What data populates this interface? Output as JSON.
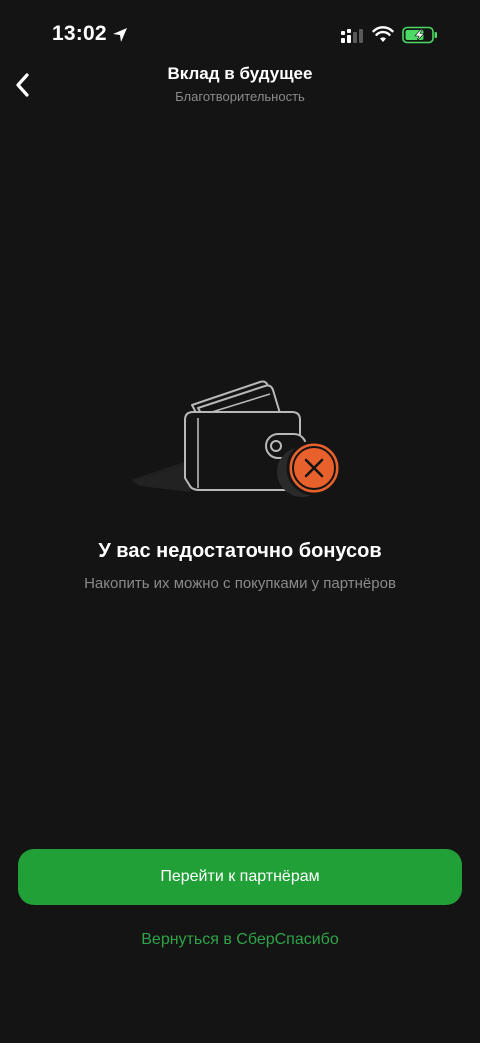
{
  "status_bar": {
    "time": "13:02",
    "location_icon": "location-arrow-icon",
    "signal_icon": "cellular-signal-icon",
    "wifi_icon": "wifi-icon",
    "battery_icon": "battery-charging-icon",
    "battery_color": "#4cd964"
  },
  "header": {
    "back_icon": "chevron-left-icon",
    "title": "Вклад в будущее",
    "subtitle": "Благотворительность"
  },
  "illustration": {
    "icon": "wallet-empty-icon",
    "badge_icon": "close-icon",
    "accent_color": "#e8602c"
  },
  "empty_state": {
    "title": "У вас недостаточно бонусов",
    "subtitle": "Накопить их можно с покупками у партнёров"
  },
  "actions": {
    "primary_label": "Перейти к партнёрам",
    "secondary_label": "Вернуться в СберСпасибо",
    "primary_color": "#21a038"
  }
}
